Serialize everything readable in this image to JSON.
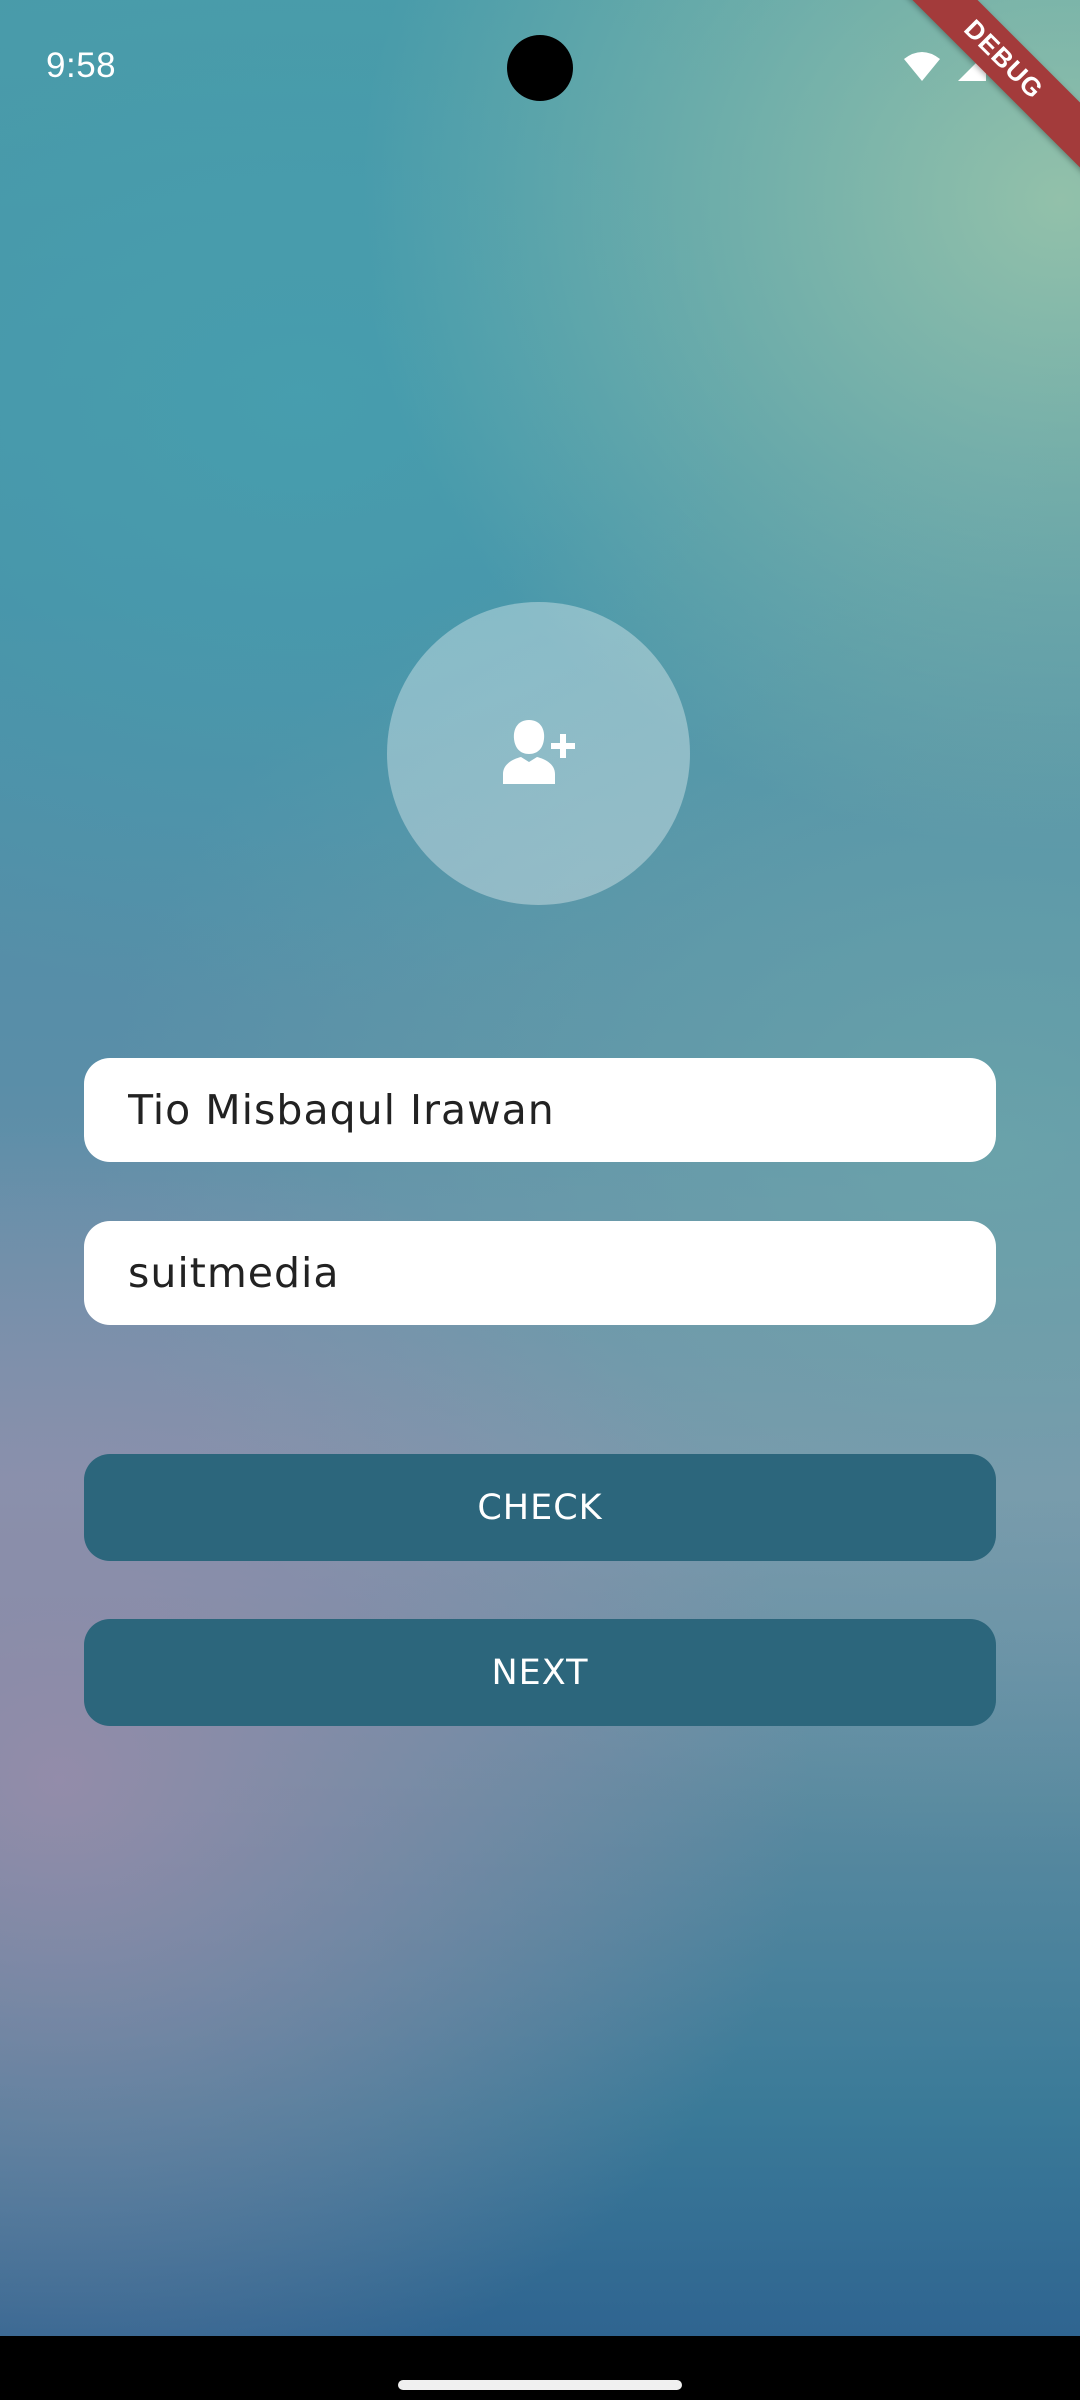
{
  "status_bar": {
    "time": "9:58",
    "icons": [
      "wifi-icon",
      "signal-icon",
      "battery-icon"
    ]
  },
  "debug_banner": "DEBUG",
  "avatar": {
    "icon": "person-add-icon"
  },
  "form": {
    "name_value": "Tio Misbaqul Irawan",
    "palindrome_value": "suitmedia"
  },
  "buttons": {
    "check_label": "CHECK",
    "next_label": "NEXT"
  },
  "colors": {
    "button_bg": "#2c667c",
    "debug_banner": "#a33b3b"
  }
}
